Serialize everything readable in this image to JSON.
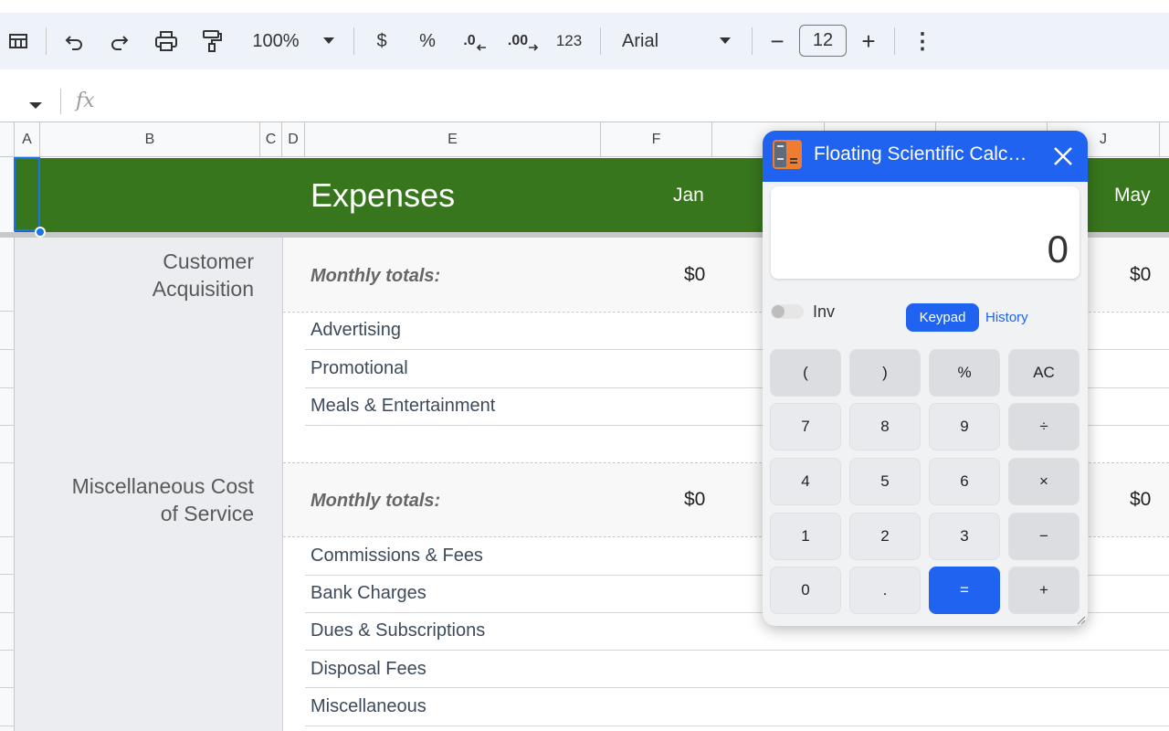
{
  "toolbar": {
    "zoom": "100%",
    "currency": "$",
    "percent": "%",
    "decrease_decimal": ".0",
    "increase_decimal": ".00",
    "number_format": "123",
    "font": "Arial",
    "minus": "−",
    "font_size": "12",
    "plus": "+",
    "more": "⋮"
  },
  "formula_bar": {
    "fx": "fx"
  },
  "columns": [
    "A",
    "B",
    "C",
    "D",
    "E",
    "F",
    "J"
  ],
  "sheet": {
    "header": {
      "title": "Expenses",
      "month1": "Jan",
      "month2": "May"
    },
    "categories": [
      {
        "name_line1": "Customer",
        "name_line2": "Acquisition",
        "totals_label": "Monthly totals:",
        "total_jan": "$0",
        "total_may": "$0",
        "items": [
          "Advertising",
          "Promotional",
          "Meals & Entertainment"
        ]
      },
      {
        "name_line1": "Miscellaneous Cost",
        "name_line2": "of Service",
        "totals_label": "Monthly totals:",
        "total_jan": "$0",
        "total_may": "$0",
        "items": [
          "Commissions & Fees",
          "Bank Charges",
          "Dues & Subscriptions",
          "Disposal Fees",
          "Miscellaneous"
        ]
      }
    ]
  },
  "calculator": {
    "title": "Floating Scientific Calc…",
    "close": "✕",
    "display": "0",
    "inv_label": "Inv",
    "tabs": {
      "keypad": "Keypad",
      "history": "History"
    },
    "keys": [
      [
        "(",
        ")",
        "%",
        "AC"
      ],
      [
        "7",
        "8",
        "9",
        "÷"
      ],
      [
        "4",
        "5",
        "6",
        "×"
      ],
      [
        "1",
        "2",
        "3",
        "−"
      ],
      [
        "0",
        ".",
        "=",
        "+"
      ]
    ]
  }
}
